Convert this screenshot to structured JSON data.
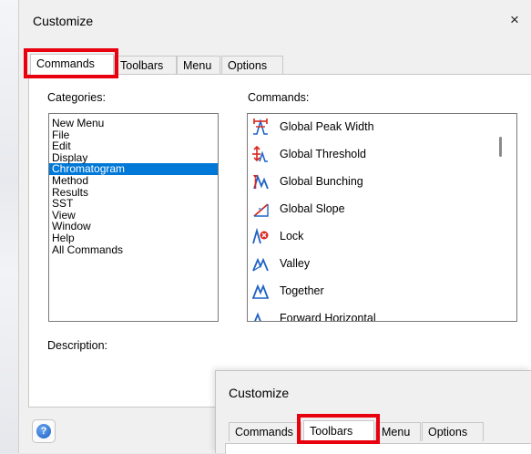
{
  "dialog": {
    "title": "Customize",
    "close": "×",
    "tabs": [
      {
        "label": "Commands",
        "active": true
      },
      {
        "label": "Toolbars",
        "active": false
      },
      {
        "label": "Menu",
        "active": false
      },
      {
        "label": "Options",
        "active": false
      }
    ],
    "categories_label": "Categories:",
    "commands_label": "Commands:",
    "description_label": "Description:",
    "categories": [
      "New Menu",
      "File",
      "Edit",
      "Display",
      "Chromatogram",
      "Method",
      "Results",
      "SST",
      "View",
      "Window",
      "Help",
      "All Commands"
    ],
    "selected_category": "Chromatogram",
    "commands": [
      {
        "label": "Global Peak Width",
        "icon": "peak-width-icon"
      },
      {
        "label": "Global Threshold",
        "icon": "threshold-icon"
      },
      {
        "label": "Global Bunching",
        "icon": "bunching-icon"
      },
      {
        "label": "Global Slope",
        "icon": "slope-icon"
      },
      {
        "label": "Lock",
        "icon": "lock-peak-icon"
      },
      {
        "label": "Valley",
        "icon": "valley-icon"
      },
      {
        "label": "Together",
        "icon": "together-icon"
      },
      {
        "label": "Forward Horizontal",
        "icon": "forward-horizontal-icon"
      }
    ],
    "help": "?"
  },
  "dialog2": {
    "title": "Customize",
    "tabs": [
      {
        "label": "Commands",
        "active": false
      },
      {
        "label": "Toolbars",
        "active": true
      },
      {
        "label": "Menu",
        "active": false
      },
      {
        "label": "Options",
        "active": false
      }
    ]
  },
  "colors": {
    "highlight": "#e8000f",
    "selection": "#0078d7",
    "icon_red": "#d9261c",
    "icon_blue": "#1f63c6"
  }
}
